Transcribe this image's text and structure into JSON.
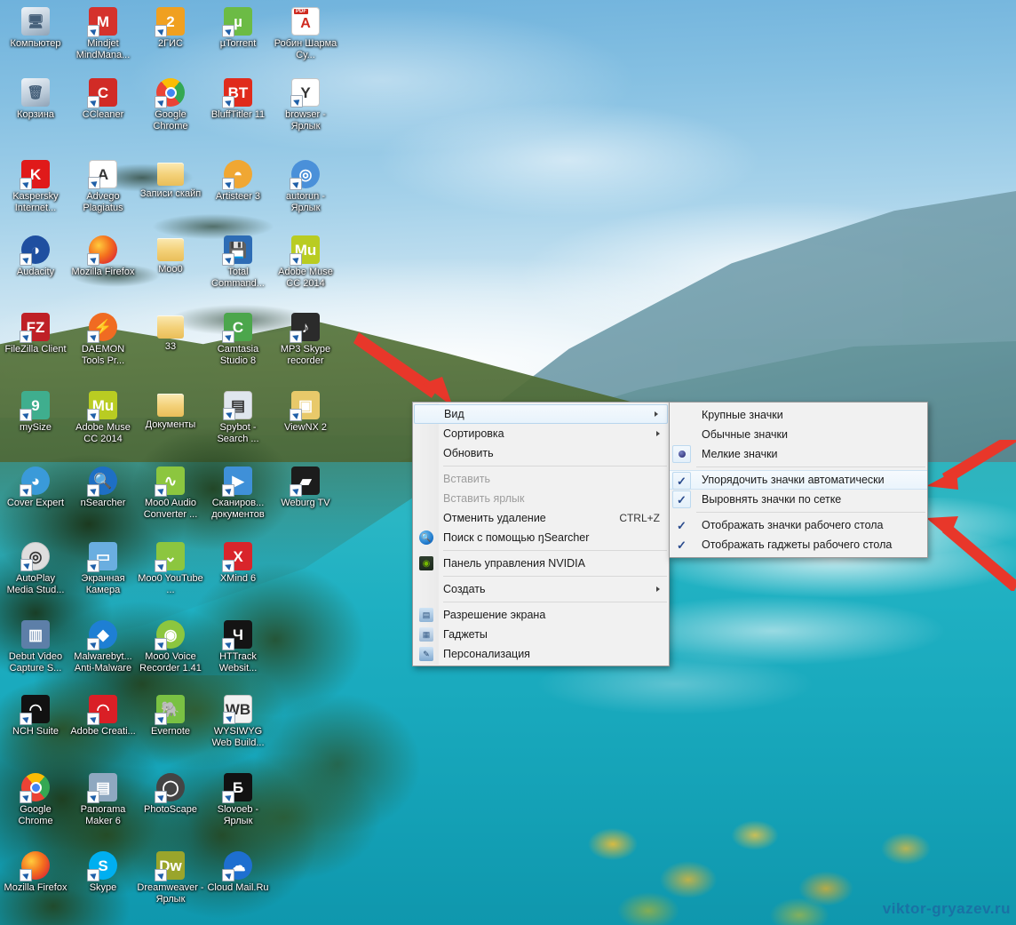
{
  "desktop": {
    "watermark": "viktor-gryazev.ru",
    "icons": [
      {
        "label": "Компьютер",
        "icon": "computer-icon",
        "shortcut": false,
        "color": "#cfd6de",
        "glyph": "🖥",
        "col": 0,
        "row": 0
      },
      {
        "label": "Mindjet MindMana...",
        "icon": "mindjet-icon",
        "shortcut": true,
        "color": "#d5322c",
        "glyph": "M",
        "col": 1,
        "row": 0
      },
      {
        "label": "2ГИС",
        "icon": "2gis-icon",
        "shortcut": true,
        "color": "#f0a020",
        "glyph": "2",
        "col": 2,
        "row": 0
      },
      {
        "label": "µTorrent",
        "icon": "utorrent-icon",
        "shortcut": true,
        "color": "#6cbb45",
        "glyph": "µ",
        "col": 3,
        "row": 0
      },
      {
        "label": "Робин Шарма Су...",
        "icon": "pdf-document-icon",
        "shortcut": false,
        "color": "#ffffff",
        "glyph": "PDF",
        "col": 4,
        "row": 0
      },
      {
        "label": "Корзина",
        "icon": "recycle-bin-icon",
        "shortcut": false,
        "color": "#c9d8e4",
        "glyph": "🗑",
        "col": 0,
        "row": 1
      },
      {
        "label": "CCleaner",
        "icon": "ccleaner-icon",
        "shortcut": true,
        "color": "#d12b26",
        "glyph": "C",
        "col": 1,
        "row": 1
      },
      {
        "label": "Google Chrome",
        "icon": "chrome-icon",
        "shortcut": true,
        "color": "#4285f4",
        "glyph": "◉",
        "col": 2,
        "row": 1
      },
      {
        "label": "BluffTitler 11",
        "icon": "blufftitler-icon",
        "shortcut": true,
        "color": "#e02b1c",
        "glyph": "BT",
        "col": 3,
        "row": 1
      },
      {
        "label": "browser - Ярлык",
        "icon": "yandex-browser-icon",
        "shortcut": true,
        "color": "#ffffff",
        "glyph": "Y",
        "col": 4,
        "row": 1
      },
      {
        "label": "Kaspersky Internet...",
        "icon": "kaspersky-icon",
        "shortcut": true,
        "color": "#e01a1a",
        "glyph": "K",
        "col": 0,
        "row": 2
      },
      {
        "label": "Advego Plagiatus",
        "icon": "advego-icon",
        "shortcut": true,
        "color": "#ffffff",
        "glyph": "A",
        "col": 1,
        "row": 2
      },
      {
        "label": "Записи скайп",
        "icon": "folder-icon",
        "shortcut": false,
        "color": "#f5d98a",
        "glyph": "",
        "col": 2,
        "row": 2
      },
      {
        "label": "Artisteer 3",
        "icon": "artisteer-icon",
        "shortcut": true,
        "color": "#f0a733",
        "glyph": "◓",
        "col": 3,
        "row": 2
      },
      {
        "label": "autorun - Ярлык",
        "icon": "autorun-disc-icon",
        "shortcut": true,
        "color": "#4a90d9",
        "glyph": "◎",
        "col": 4,
        "row": 2
      },
      {
        "label": "Audacity",
        "icon": "audacity-icon",
        "shortcut": true,
        "color": "#1f4fa0",
        "glyph": "◑",
        "col": 0,
        "row": 3
      },
      {
        "label": "Mozilla Firefox",
        "icon": "firefox-icon",
        "shortcut": true,
        "color": "#e8620c",
        "glyph": "◐",
        "col": 1,
        "row": 3
      },
      {
        "label": "Moo0",
        "icon": "folder-icon",
        "shortcut": false,
        "color": "#f5d98a",
        "glyph": "",
        "col": 2,
        "row": 3
      },
      {
        "label": "Total Command...",
        "icon": "total-commander-icon",
        "shortcut": true,
        "color": "#2d6cb5",
        "glyph": "💾",
        "col": 3,
        "row": 3
      },
      {
        "label": "Adobe Muse CC 2014",
        "icon": "adobe-muse-icon",
        "shortcut": true,
        "color": "#b9cc22",
        "glyph": "Mu",
        "col": 4,
        "row": 3
      },
      {
        "label": "FileZilla Client",
        "icon": "filezilla-icon",
        "shortcut": true,
        "color": "#bf2026",
        "glyph": "FZ",
        "col": 0,
        "row": 4
      },
      {
        "label": "DAEMON Tools Pr...",
        "icon": "daemon-tools-icon",
        "shortcut": true,
        "color": "#f06b22",
        "glyph": "⚡",
        "col": 1,
        "row": 4
      },
      {
        "label": "33",
        "icon": "folder-icon",
        "shortcut": false,
        "color": "#f5d98a",
        "glyph": "",
        "col": 2,
        "row": 4
      },
      {
        "label": "Camtasia Studio 8",
        "icon": "camtasia-icon",
        "shortcut": true,
        "color": "#4ca64c",
        "glyph": "C",
        "col": 3,
        "row": 4
      },
      {
        "label": "MP3 Skype recorder",
        "icon": "mp3-skype-recorder-icon",
        "shortcut": true,
        "color": "#2b2b2b",
        "glyph": "♪",
        "col": 4,
        "row": 4
      },
      {
        "label": "mySize",
        "icon": "mysize-icon",
        "shortcut": true,
        "color": "#3fae8e",
        "glyph": "9",
        "col": 0,
        "row": 5
      },
      {
        "label": "Adobe Muse CC 2014",
        "icon": "adobe-muse-icon",
        "shortcut": true,
        "color": "#b9cc22",
        "glyph": "Mu",
        "col": 1,
        "row": 5
      },
      {
        "label": "Документы",
        "icon": "folder-icon",
        "shortcut": false,
        "color": "#f5d98a",
        "glyph": "",
        "col": 2,
        "row": 5
      },
      {
        "label": "Spybot - Search ...",
        "icon": "spybot-icon",
        "shortcut": true,
        "color": "#dfe6ee",
        "glyph": "▤",
        "col": 3,
        "row": 5
      },
      {
        "label": "ViewNX 2",
        "icon": "viewnx-icon",
        "shortcut": true,
        "color": "#e8c96a",
        "glyph": "▣",
        "col": 4,
        "row": 5
      },
      {
        "label": "Cover Expert",
        "icon": "cover-expert-icon",
        "shortcut": true,
        "color": "#3a9ad9",
        "glyph": "◕",
        "col": 0,
        "row": 6
      },
      {
        "label": "nSearcher",
        "icon": "nsearcher-icon",
        "shortcut": true,
        "color": "#1e6fc4",
        "glyph": "🔍",
        "col": 1,
        "row": 6
      },
      {
        "label": "Moo0 Audio Converter ...",
        "icon": "moo0-audio-converter-icon",
        "shortcut": true,
        "color": "#8cc63f",
        "glyph": "∿",
        "col": 2,
        "row": 6
      },
      {
        "label": "Сканиров... документов",
        "icon": "scanner-icon",
        "shortcut": true,
        "color": "#3f90d8",
        "glyph": "▶",
        "col": 3,
        "row": 6
      },
      {
        "label": "Weburg TV",
        "icon": "weburg-tv-icon",
        "shortcut": true,
        "color": "#1c1c1c",
        "glyph": "▰",
        "col": 4,
        "row": 6
      },
      {
        "label": "AutoPlay Media Stud...",
        "icon": "autoplay-media-studio-icon",
        "shortcut": true,
        "color": "#dedede",
        "glyph": "◎",
        "col": 0,
        "row": 7
      },
      {
        "label": "Экранная Камера",
        "icon": "screen-camera-icon",
        "shortcut": true,
        "color": "#6aaee0",
        "glyph": "▭",
        "col": 1,
        "row": 7
      },
      {
        "label": "Moo0 YouTube ...",
        "icon": "moo0-youtube-icon",
        "shortcut": true,
        "color": "#8cc63f",
        "glyph": "⌄",
        "col": 2,
        "row": 7
      },
      {
        "label": "XMind 6",
        "icon": "xmind-icon",
        "shortcut": true,
        "color": "#d9252b",
        "glyph": "X",
        "col": 3,
        "row": 7
      },
      {
        "label": "Debut Video Capture S...",
        "icon": "debut-video-capture-icon",
        "shortcut": false,
        "color": "#5d7fa8",
        "glyph": "▥",
        "col": 0,
        "row": 8
      },
      {
        "label": "Malwarebyt... Anti-Malware",
        "icon": "malwarebytes-icon",
        "shortcut": true,
        "color": "#1e7fd4",
        "glyph": "◆",
        "col": 1,
        "row": 8
      },
      {
        "label": "Moo0 Voice Recorder 1.41",
        "icon": "moo0-voice-recorder-icon",
        "shortcut": true,
        "color": "#8cc63f",
        "glyph": "◉",
        "col": 2,
        "row": 8
      },
      {
        "label": "HTTrack Websit...",
        "icon": "httrack-icon",
        "shortcut": true,
        "color": "#141414",
        "glyph": "Ч",
        "col": 3,
        "row": 8
      },
      {
        "label": "NCH Suite",
        "icon": "nch-suite-icon",
        "shortcut": true,
        "color": "#111111",
        "glyph": "◠",
        "col": 0,
        "row": 9
      },
      {
        "label": "Adobe Creati...",
        "icon": "adobe-creative-cloud-icon",
        "shortcut": true,
        "color": "#da1f26",
        "glyph": "◠",
        "col": 1,
        "row": 9
      },
      {
        "label": "Evernote",
        "icon": "evernote-icon",
        "shortcut": true,
        "color": "#7ac143",
        "glyph": "🐘",
        "col": 2,
        "row": 9
      },
      {
        "label": "WYSIWYG Web Build...",
        "icon": "wysiwyg-web-builder-icon",
        "shortcut": true,
        "color": "#f2f2f2",
        "glyph": "WB",
        "col": 3,
        "row": 9
      },
      {
        "label": "Google Chrome",
        "icon": "chrome-icon",
        "shortcut": true,
        "color": "#4285f4",
        "glyph": "◉",
        "col": 0,
        "row": 10
      },
      {
        "label": "Panorama Maker 6",
        "icon": "panorama-maker-icon",
        "shortcut": true,
        "color": "#8fa8c0",
        "glyph": "▤",
        "col": 1,
        "row": 10
      },
      {
        "label": "PhotoScape",
        "icon": "photoscape-icon",
        "shortcut": true,
        "color": "#444444",
        "glyph": "◯",
        "col": 2,
        "row": 10
      },
      {
        "label": "Slovoeb - Ярлык",
        "icon": "slovoeb-icon",
        "shortcut": true,
        "color": "#111111",
        "glyph": "Б",
        "col": 3,
        "row": 10
      },
      {
        "label": "Mozilla Firefox",
        "icon": "firefox-icon",
        "shortcut": true,
        "color": "#e8620c",
        "glyph": "◐",
        "col": 0,
        "row": 11
      },
      {
        "label": "Skype",
        "icon": "skype-icon",
        "shortcut": true,
        "color": "#00aff0",
        "glyph": "S",
        "col": 1,
        "row": 11
      },
      {
        "label": "Dreamweaver - Ярлык",
        "icon": "dreamweaver-icon",
        "shortcut": true,
        "color": "#9aa52b",
        "glyph": "Dw",
        "col": 2,
        "row": 11
      },
      {
        "label": "Cloud Mail.Ru",
        "icon": "cloud-mailru-icon",
        "shortcut": true,
        "color": "#1e6fd0",
        "glyph": "☁",
        "col": 3,
        "row": 11
      }
    ]
  },
  "context_menu": {
    "items": [
      {
        "label": "Вид",
        "type": "submenu",
        "highlighted": true,
        "disabled": false,
        "icon": null,
        "accel": ""
      },
      {
        "label": "Сортировка",
        "type": "submenu",
        "highlighted": false,
        "disabled": false,
        "icon": null,
        "accel": ""
      },
      {
        "label": "Обновить",
        "type": "item",
        "highlighted": false,
        "disabled": false,
        "icon": null,
        "accel": ""
      },
      {
        "type": "separator"
      },
      {
        "label": "Вставить",
        "type": "item",
        "highlighted": false,
        "disabled": true,
        "icon": null,
        "accel": ""
      },
      {
        "label": "Вставить ярлык",
        "type": "item",
        "highlighted": false,
        "disabled": true,
        "icon": null,
        "accel": ""
      },
      {
        "label": "Отменить удаление",
        "type": "item",
        "highlighted": false,
        "disabled": false,
        "icon": null,
        "accel": "CTRL+Z"
      },
      {
        "label": "Поиск с помощью ŋSearcher",
        "type": "item",
        "highlighted": false,
        "disabled": false,
        "icon": "search-icon",
        "accel": ""
      },
      {
        "type": "separator"
      },
      {
        "label": "Панель управления NVIDIA",
        "type": "item",
        "highlighted": false,
        "disabled": false,
        "icon": "nvidia-icon",
        "accel": ""
      },
      {
        "type": "separator"
      },
      {
        "label": "Создать",
        "type": "submenu",
        "highlighted": false,
        "disabled": false,
        "icon": null,
        "accel": ""
      },
      {
        "type": "separator"
      },
      {
        "label": "Разрешение экрана",
        "type": "item",
        "highlighted": false,
        "disabled": false,
        "icon": "monitor-icon",
        "accel": ""
      },
      {
        "label": "Гаджеты",
        "type": "item",
        "highlighted": false,
        "disabled": false,
        "icon": "gadgets-icon",
        "accel": ""
      },
      {
        "label": "Персонализация",
        "type": "item",
        "highlighted": false,
        "disabled": false,
        "icon": "personalize-icon",
        "accel": ""
      }
    ]
  },
  "submenu": {
    "items": [
      {
        "label": "Крупные значки",
        "mark": "none",
        "highlighted": false,
        "framed": false
      },
      {
        "label": "Обычные значки",
        "mark": "none",
        "highlighted": false,
        "framed": false
      },
      {
        "label": "Мелкие значки",
        "mark": "radio",
        "highlighted": false,
        "framed": true
      },
      {
        "type": "separator"
      },
      {
        "label": "Упорядочить значки автоматически",
        "mark": "check",
        "highlighted": true,
        "framed": true
      },
      {
        "label": "Выровнять значки по сетке",
        "mark": "check",
        "highlighted": false,
        "framed": true
      },
      {
        "type": "separator"
      },
      {
        "label": "Отображать значки рабочего стола",
        "mark": "check",
        "highlighted": false,
        "framed": false
      },
      {
        "label": "Отображать гаджеты  рабочего стола",
        "mark": "check",
        "highlighted": false,
        "framed": false
      }
    ]
  },
  "annotations": {
    "arrow_color": "#e8372a",
    "arrows": [
      {
        "name": "arrow-to-view-item",
        "points_to": "Вид"
      },
      {
        "name": "arrow-to-auto-arrange",
        "points_to": "Упорядочить значки автоматически"
      },
      {
        "name": "arrow-to-align-to-grid",
        "points_to": "Выровнять значки по сетке"
      }
    ]
  }
}
